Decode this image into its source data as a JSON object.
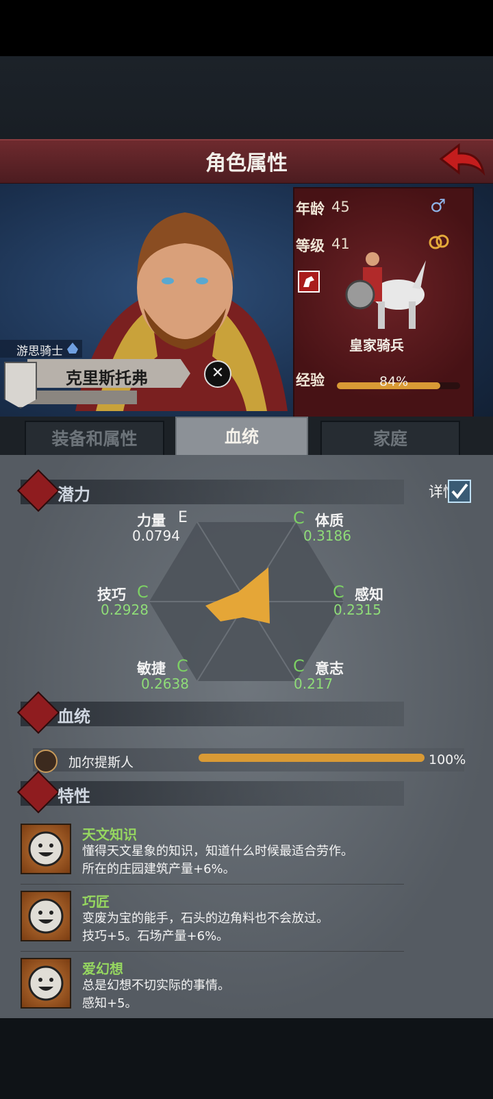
{
  "header": {
    "title": "角色属性"
  },
  "character": {
    "class": "游思骑士",
    "name": "克里斯托弗",
    "age_label": "年龄",
    "age": "45",
    "level_label": "等级",
    "level": "41",
    "unit": "皇家骑兵",
    "exp_label": "经验",
    "exp": "84%",
    "exp_fraction": 0.84
  },
  "tabs": [
    {
      "label": "装备和属性"
    },
    {
      "label": "血统"
    },
    {
      "label": "家庭"
    }
  ],
  "potential": {
    "section": "潜力",
    "details_label": "详情",
    "stats": [
      {
        "label": "力量",
        "grade": "E",
        "value": "0.0794"
      },
      {
        "label": "体质",
        "grade": "C",
        "value": "0.3186"
      },
      {
        "label": "感知",
        "grade": "C",
        "value": "0.2315"
      },
      {
        "label": "意志",
        "grade": "C",
        "value": "0.217"
      },
      {
        "label": "敏捷",
        "grade": "C",
        "value": "0.2638"
      },
      {
        "label": "技巧",
        "grade": "C",
        "value": "0.2928"
      }
    ]
  },
  "bloodline": {
    "section": "血统",
    "name": "加尔提斯人",
    "percent": "100%",
    "fraction": 1.0
  },
  "traits": {
    "section": "特性",
    "items": [
      {
        "name": "天文知识",
        "line1": "懂得天文星象的知识，知道什么时候最适合劳作。",
        "line2": "所在的庄园建筑产量+6%。"
      },
      {
        "name": "巧匠",
        "line1": "变废为宝的能手，石头的边角料也不会放过。",
        "line2": "技巧+5。石场产量+6%。"
      },
      {
        "name": "爱幻想",
        "line1": "总是幻想不切实际的事情。",
        "line2": "感知+5。"
      }
    ]
  },
  "colors": {
    "accent": "#d99a35",
    "grade": "#7cd064",
    "trait_name": "#96d760",
    "title_bar": "#5e2428"
  }
}
